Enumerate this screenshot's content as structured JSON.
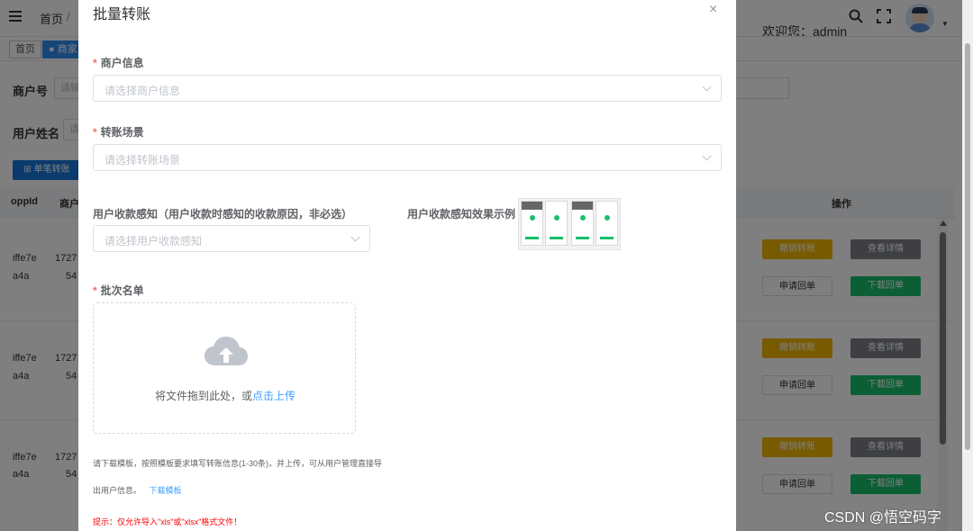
{
  "topbar": {
    "breadcrumb_home": "首页",
    "breadcrumb_sep": "/",
    "welcome": "欢迎您：admin",
    "search_icon": "search-icon",
    "fullscreen_icon": "fullscreen-icon"
  },
  "tags": {
    "home": "首页",
    "active": "● 商家"
  },
  "filters": {
    "merchant_no_label": "商户号",
    "merchant_no_placeholder": "请输",
    "user_name_label": "用户姓名",
    "user_name_placeholder": "请"
  },
  "toolbar": {
    "single_transfer": "单笔转账"
  },
  "table": {
    "headers": [
      "oppId",
      "商户",
      "操作"
    ],
    "rows": [
      {
        "id_line1": "iffe7e",
        "id_line2": "a4a",
        "merchant_line1": "1727",
        "merchant_line2": "54"
      },
      {
        "id_line1": "iffe7e",
        "id_line2": "a4a",
        "merchant_line1": "1727",
        "merchant_line2": "54"
      },
      {
        "id_line1": "iffe7e",
        "id_line2": "a4a",
        "merchant_line1": "1727",
        "merchant_line2": "54"
      }
    ],
    "actions": {
      "revoke": "撤销转账",
      "view": "查看详情",
      "apply_receipt": "申请回单",
      "download_receipt": "下载回单"
    }
  },
  "dialog": {
    "title": "批量转账",
    "close": "×",
    "merchant_label": "商户信息",
    "merchant_placeholder": "请选择商户信息",
    "scene_label": "转账场景",
    "scene_placeholder": "请选择转账场景",
    "perception_label": "用户收款感知（用户收款时感知的收款原因，非必选）",
    "perception_placeholder": "请选择用户收款感知",
    "example_label": "用户收款感知效果示例",
    "batch_label": "批次名单",
    "upload_text": "将文件拖到此处，或",
    "upload_link": "点击上传",
    "tip_line1": "请下载模板，按照模板要求填写转账信息(1-30条)，并上传，可从用户管理直接导",
    "tip_line2": "出用户信息。",
    "download_template": "下载模板",
    "warning": "提示：仅允许导入\"xls\"或\"xlsx\"格式文件！"
  },
  "watermark": "CSDN @悟空码字"
}
